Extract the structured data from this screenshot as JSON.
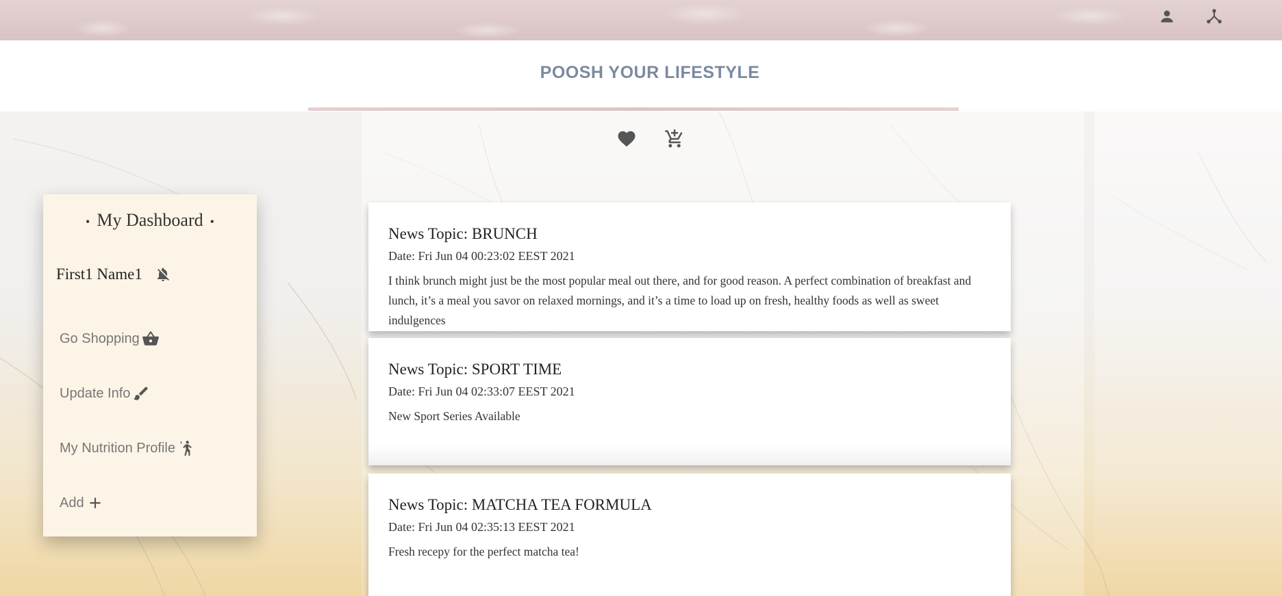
{
  "header": {
    "icons": [
      "account-icon",
      "hub-icon"
    ],
    "site_title": "POOSH YOUR LIFESTYLE"
  },
  "actions": {
    "icons": [
      "heart-icon",
      "add-cart-icon"
    ]
  },
  "sidebar": {
    "title": "My Dashboard",
    "user_name": "First1 Name1",
    "items": [
      {
        "label": "Go Shopping",
        "icon": "shopping-basket-icon"
      },
      {
        "label": "Update Info",
        "icon": "brush-icon"
      },
      {
        "label": "My Nutrition Profile",
        "icon": "person-walking-icon"
      },
      {
        "label": "Add",
        "icon": "plus-icon"
      }
    ]
  },
  "news": [
    {
      "topic": "News Topic: BRUNCH",
      "date": "Date: Fri Jun 04 00:23:02 EEST 2021",
      "body": "I think brunch might just be the most popular meal out there, and for good reason. A perfect combination of breakfast and lunch, it’s a meal you savor on relaxed mornings, and it’s a time to load up on fresh, healthy foods as well as sweet indulgences"
    },
    {
      "topic": "News Topic: SPORT TIME",
      "date": "Date: Fri Jun 04 02:33:07 EEST 2021",
      "body": "New Sport Series Available"
    },
    {
      "topic": "News Topic: MATCHA TEA FORMULA",
      "date": "Date: Fri Jun 04 02:35:13 EEST 2021",
      "body": "Fresh recepy for the perfect matcha tea!"
    }
  ],
  "colors": {
    "title": "#7b8a9d",
    "sidebar_bg": "#fcf4e6",
    "icon": "#555555",
    "topbar": "#dcc8c9"
  }
}
